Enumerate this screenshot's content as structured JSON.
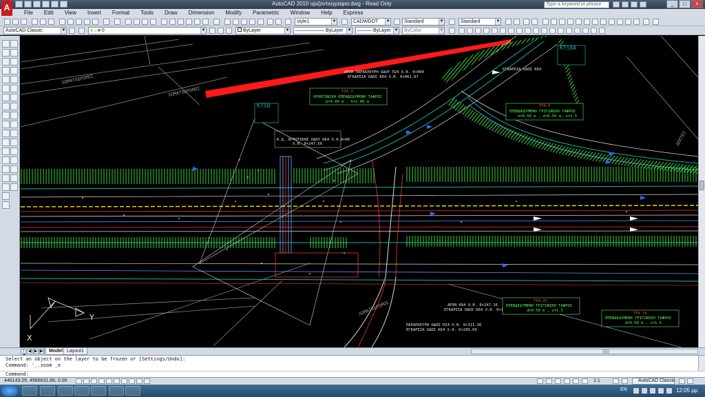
{
  "window": {
    "title": "AutoCAD 2010     οριζοντιογραφια.dwg - Read Only",
    "search_placeholder": "Type a keyword or phrase",
    "logo": "A"
  },
  "menu": [
    "File",
    "Edit",
    "View",
    "Insert",
    "Format",
    "Tools",
    "Draw",
    "Dimension",
    "Modify",
    "Parametric",
    "Window",
    "Help",
    "Express"
  ],
  "toolbar": {
    "text_style": "style1",
    "dim_style": "CADWDOT",
    "table_style": "Standard",
    "multileader_style": "Standard",
    "workspace": "AutoCAD Classic",
    "layer": "0",
    "color": "ByLayer",
    "linetype": "ByLayer",
    "lineweight": "ByLayer",
    "plotstyle": "ByColor"
  },
  "drawing": {
    "labels": {
      "road_top": "ΧΩΜΑΤΟΔΡΟΜΟΣ",
      "road_mid": "ΧΩΜΑΤΟΔΡΟΜΟΣ",
      "road_bottom": "ΧΩΜΑΤΟΔΡΟΜΟΣ",
      "parallel_road": "ΑΡΧΗ ΠΑΡΑΠΛΕΥΡΗ ΟΔΟΥ Π24 Χ.Θ. 0+000",
      "parallel_road_2": "ΕΓΚΑΡΣΙΑ ΟΔΟΣ Κ64 Χ.Θ. 0+061.97",
      "transverse": "ΕΓΚΑΡΣΙΑ ΟΔΟΣ Κ64",
      "rural_road": "Κ.Δ. ΑΓΡΟΤΙΚΗΣ ΟΔΟΥ Κ64 Χ.Θ.0+00",
      "rural_road_2": "Χ.Θ. 0+247.56",
      "start_road": "ΑΡΧΗ Κ64 Χ.Θ. 0+247.16",
      "start_road_2": "ΕΓΚΑΡΣΙΑ ΟΔΟΣ Κ64 Χ.Θ. 0+177.31",
      "parallel_bottom": "ΠΑΡΑΠΛΕΥΡΗ ΟΔΟΣ Π24 Χ.Θ. 0+311.36",
      "parallel_bottom_2": "ΕΓΚΑΡΣΙΑ ΟΔΟΣ Κ64 Χ.Θ. 0+209.09",
      "dektes": "ΔΕΚΤΕΣ"
    },
    "boxes": [
      {
        "id": "TZA.3",
        "line1": "ΟΡΘΟΓΩΝΙΚΗ ΕΠΕΝΔΕΔΥΜΕΝΗ ΤΑΦΡΟΣ",
        "line2": "b=4.00 m , h=2.00 m"
      },
      {
        "id": "TPA.6",
        "line1": "ΕΠΕΝΔΕΔΥΜΕΝΗ ΤΡΙΓΩΝΙΚΗ ΤΑΦΡΟΣ",
        "line2": "h=0.50 m , d=0.50 m, z=1.5"
      },
      {
        "id": "TPA.25",
        "line1": "ΕΠΕΝΔΕΔΥΜΕΝΗ ΤΡΙΓΩΝΙΚΗ ΤΑΦΡΟΣ",
        "line2": "d=0.50 m , z=1.5"
      },
      {
        "id": "TPA.20",
        "line1": "ΕΠΕΝΔΕΔΥΜΕΝΗ ΤΡΙΓΩΝΙΚΗ ΤΑΦΡΟΣ",
        "line2": "d=0.50 m , z=1.5"
      }
    ],
    "kt_top": "KT58A",
    "kt_left": "KT58",
    "ucs_x": "X",
    "ucs_y": "Y"
  },
  "tabs": [
    "Model",
    "Layout1"
  ],
  "command": {
    "line1": "Select an object on the layer to be frozen or [Settings/Undo]:",
    "line2": "Command: '_.zoom _e",
    "prompt": "Command:"
  },
  "status": {
    "coordinates": "446143.26, 4566631.86, 0.00",
    "annotation_scale": "1:1",
    "workspace": "AutoCAD Classic"
  },
  "taskbar": {
    "language": "EN",
    "time": "12:05 μμ"
  }
}
